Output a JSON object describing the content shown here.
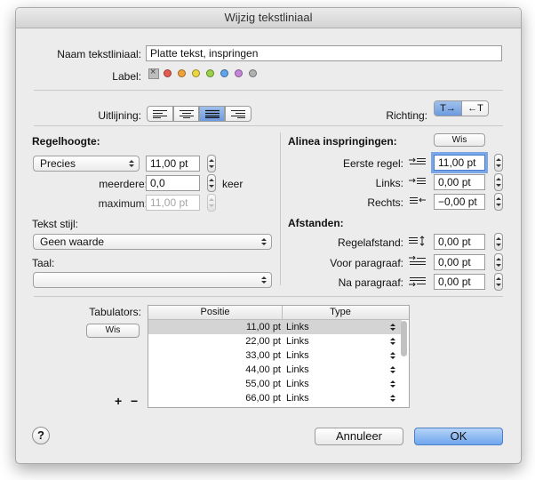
{
  "window": {
    "title": "Wijzig tekstliniaal"
  },
  "name": {
    "label": "Naam tekstliniaal:",
    "value": "Platte tekst, inspringen"
  },
  "label_row": {
    "label": "Label:",
    "colors": [
      "#e35b4f",
      "#f0a13a",
      "#ecd53f",
      "#9bd049",
      "#5fa3ea",
      "#c586d9",
      "#b0b0b0"
    ]
  },
  "alignment": {
    "label": "Uitlijning:",
    "options": [
      "align-left-icon",
      "align-center-icon",
      "align-justify-icon",
      "align-right-icon"
    ],
    "selected": 2
  },
  "direction": {
    "label": "Richting:",
    "ltr": "T→",
    "rtl": "←T"
  },
  "line_height": {
    "title": "Regelhoogte:",
    "mode": "Precies",
    "value": "11,00 pt",
    "multiple_label": "meerdere:",
    "multiple_value": "0,0",
    "multiple_unit": "keer",
    "max_label": "maximum:",
    "max_value": "11,00 pt"
  },
  "text_style": {
    "label": "Tekst stijl:",
    "value": "Geen waarde"
  },
  "language": {
    "label": "Taal:",
    "value": ""
  },
  "indent": {
    "title": "Alinea inspringingen:",
    "clear_label": "Wis",
    "first_label": "Eerste regel:",
    "first_value": "11,00 pt",
    "left_label": "Links:",
    "left_value": "0,00 pt",
    "right_label": "Rechts:",
    "right_value": "−0,00 pt"
  },
  "spacing": {
    "title": "Afstanden:",
    "line_label": "Regelafstand:",
    "line_value": "0,00 pt",
    "before_label": "Voor paragraaf:",
    "before_value": "0,00 pt",
    "after_label": "Na paragraaf:",
    "after_value": "0,00 pt"
  },
  "tabs": {
    "label": "Tabulators:",
    "clear_label": "Wis",
    "add": "+",
    "remove": "−",
    "col_position": "Positie",
    "col_type": "Type",
    "rows": [
      {
        "pos": "11,00 pt",
        "type": "Links"
      },
      {
        "pos": "22,00 pt",
        "type": "Links"
      },
      {
        "pos": "33,00 pt",
        "type": "Links"
      },
      {
        "pos": "44,00 pt",
        "type": "Links"
      },
      {
        "pos": "55,00 pt",
        "type": "Links"
      },
      {
        "pos": "66,00 pt",
        "type": "Links"
      }
    ]
  },
  "footer": {
    "help": "?",
    "cancel": "Annuleer",
    "ok": "OK"
  }
}
